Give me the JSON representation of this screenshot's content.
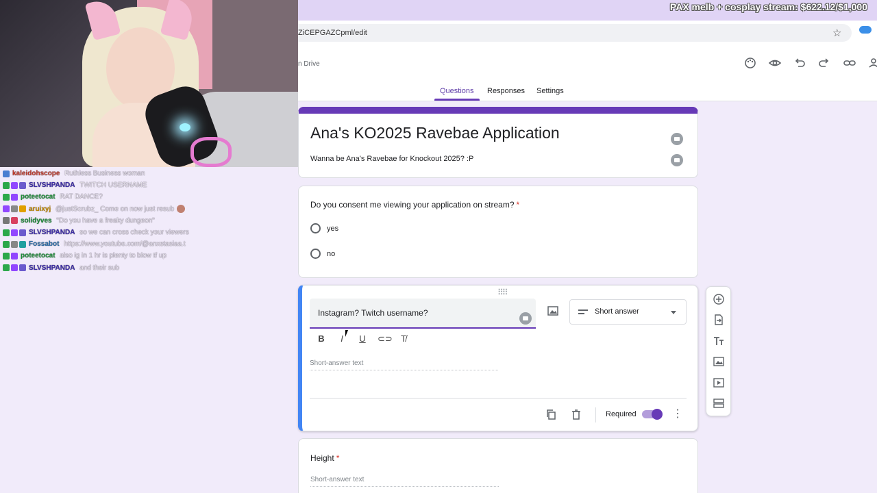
{
  "stream": {
    "goal_text": "PAX melb + cosplay stream: $622.12/$1,000"
  },
  "chat": [
    {
      "user": "kaleidohscope",
      "user_color": "#c0392b",
      "message": "Ruthless Business woman",
      "badges": [
        "#4a7fd1"
      ]
    },
    {
      "user": "SLVSHPANDA",
      "user_color": "#3b2aa8",
      "message": "TWITCH USERNAME",
      "badges": [
        "#2ba84a",
        "#9146ff",
        "#6a5acd"
      ]
    },
    {
      "user": "poteetocat",
      "user_color": "#1e8f3a",
      "message": "RAT DANCE?",
      "badges": [
        "#2ba84a",
        "#9146ff"
      ]
    },
    {
      "user": "aruixyj",
      "user_color": "#c28a00",
      "message": "@justScrubz_ Come on now just resub",
      "badges": [
        "#9146ff",
        "#888888",
        "#e0a000"
      ]
    },
    {
      "user": "solidyves",
      "user_color": "#1e8f3a",
      "message": "\"Do you have a freaky dungeon\"",
      "badges": [
        "#777777",
        "#d84060"
      ]
    },
    {
      "user": "SLVSHPANDA",
      "user_color": "#3b2aa8",
      "message": "so we can cross check your viewers",
      "badges": [
        "#2ba84a",
        "#9146ff",
        "#6a5acd"
      ]
    },
    {
      "user": "Fossabot",
      "user_color": "#2b6ca8",
      "message": "https://www.youtube.com/@anxstasiaa.t",
      "badges": [
        "#2ba84a",
        "#888888",
        "#20a0a0"
      ]
    },
    {
      "user": "poteetocat",
      "user_color": "#1e8f3a",
      "message": "also ig in 1 hr is plenty to blow tf up",
      "badges": [
        "#2ba84a",
        "#9146ff"
      ]
    },
    {
      "user": "SLVSHPANDA",
      "user_color": "#3b2aa8",
      "message": "and their sub",
      "badges": [
        "#2ba84a",
        "#9146ff",
        "#6a5acd"
      ]
    }
  ],
  "browser": {
    "url": "ZiCEPGAZCpml/edit"
  },
  "forms_header": {
    "drive_label": "n Drive",
    "tabs": [
      "Questions",
      "Responses",
      "Settings"
    ]
  },
  "form": {
    "title": "Ana's KO2025 Ravebae Application",
    "description": "Wanna be Ana's Ravebae for Knockout 2025? :P",
    "consent": {
      "question": "Do you consent me viewing your application on stream?",
      "required_mark": "*",
      "options": [
        "yes",
        "no"
      ]
    },
    "active_question": {
      "text": "Instagram? Twitch username?",
      "type": "Short answer",
      "placeholder": "Short-answer text",
      "required_label": "Required",
      "required": true
    },
    "height_question": {
      "text": "Height",
      "required_mark": "*",
      "placeholder": "Short-answer text"
    }
  },
  "colors": {
    "accent": "#673ab7",
    "active_border": "#4285f4",
    "banner": "#e0d4f5",
    "background": "#f1ebfa"
  }
}
